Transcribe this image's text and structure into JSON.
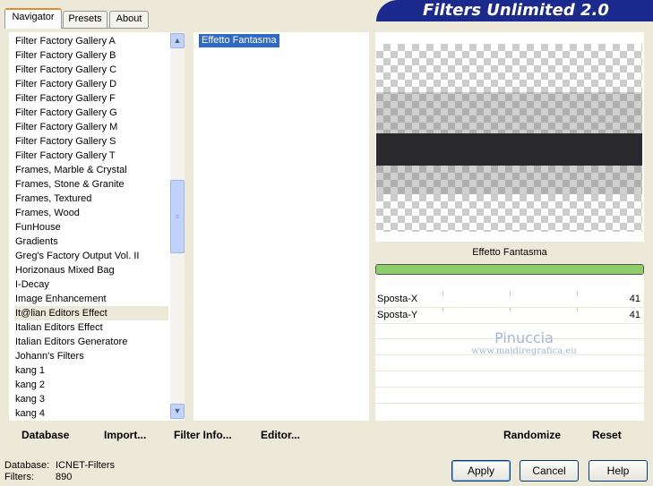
{
  "tabs": [
    {
      "label": "Navigator"
    },
    {
      "label": "Presets"
    },
    {
      "label": "About"
    }
  ],
  "app_title": "Filters Unlimited 2.0",
  "categories": [
    "Filter Factory Gallery A",
    "Filter Factory Gallery B",
    "Filter Factory Gallery C",
    "Filter Factory Gallery D",
    "Filter Factory Gallery F",
    "Filter Factory Gallery G",
    "Filter Factory Gallery M",
    "Filter Factory Gallery S",
    "Filter Factory Gallery T",
    "Frames, Marble & Crystal",
    "Frames, Stone & Granite",
    "Frames, Textured",
    "Frames, Wood",
    "FunHouse",
    "Gradients",
    "Greg's Factory Output Vol. II",
    "Horizonaus Mixed Bag",
    "I-Decay",
    "Image Enhancement",
    "It@lian Editors Effect",
    "Italian Editors Effect",
    "Italian Editors Generatore",
    "Johann's Filters",
    "kang 1",
    "kang 2",
    "kang 3",
    "kang 4"
  ],
  "selected_category": "It@lian Editors Effect",
  "effects": [
    "Effetto Fantasma"
  ],
  "selected_effect": "Effetto Fantasma",
  "preview": {
    "effect_name": "Effetto Fantasma",
    "progress": 1.0
  },
  "params": [
    {
      "label": "Sposta-X",
      "value": "41"
    },
    {
      "label": "Sposta-Y",
      "value": "41"
    }
  ],
  "watermark": {
    "name": "Pinuccia",
    "url": "www.maidiregrafica.eu"
  },
  "commands": {
    "database": "Database",
    "import": "Import...",
    "filter_info": "Filter Info...",
    "editor": "Editor...",
    "randomize": "Randomize",
    "reset": "Reset"
  },
  "status": {
    "database_label": "Database:",
    "database_value": "ICNET-Filters",
    "filters_label": "Filters:",
    "filters_value": "890"
  },
  "buttons": {
    "apply": "Apply",
    "cancel": "Cancel",
    "help": "Help"
  }
}
